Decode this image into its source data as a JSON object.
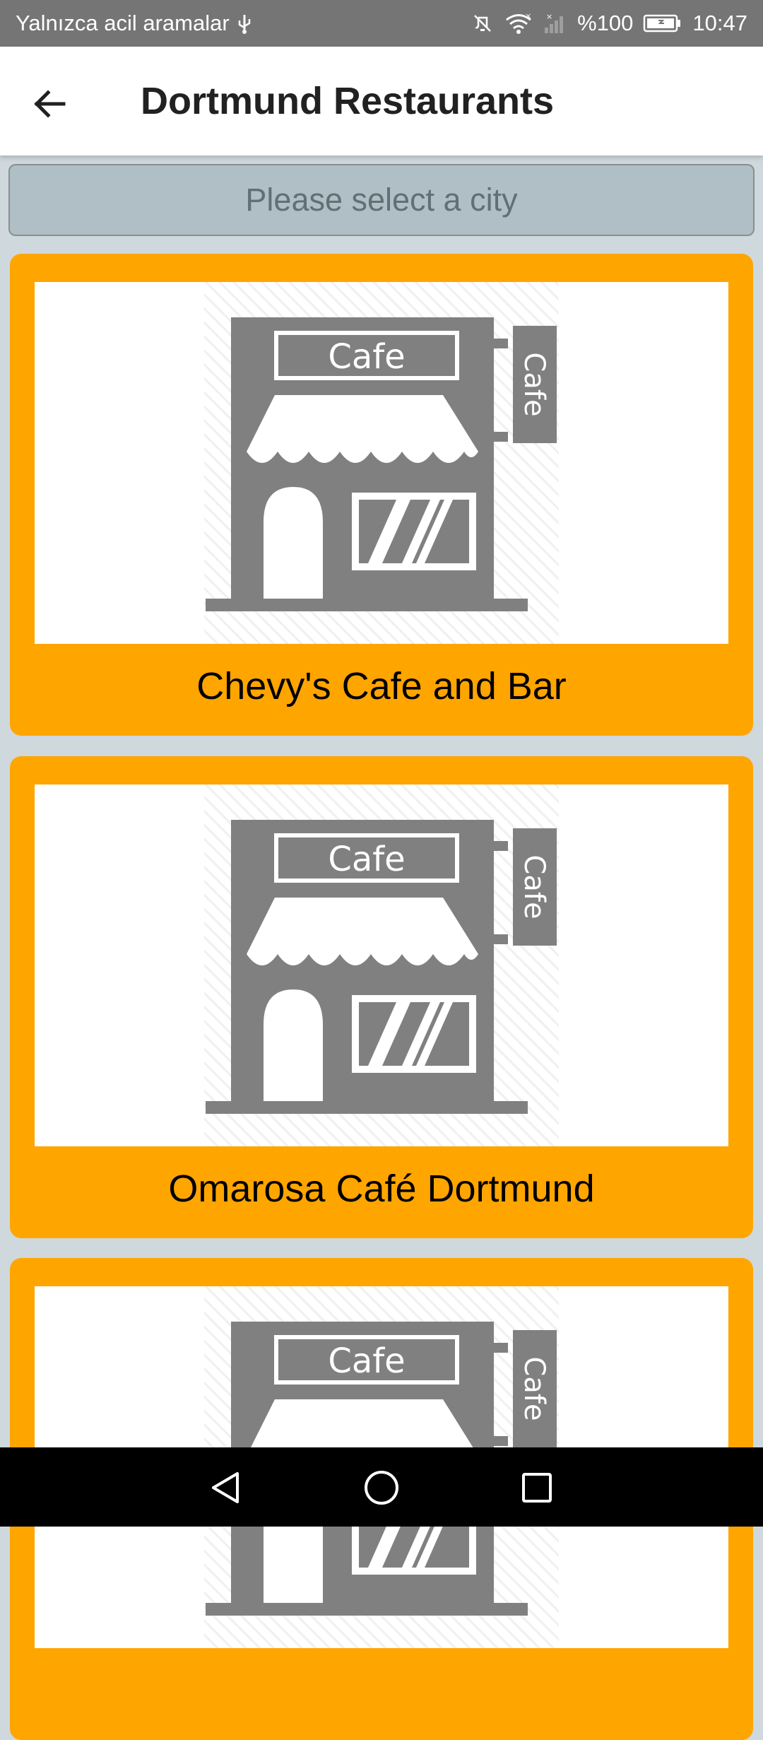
{
  "status_bar": {
    "carrier_text": "Yalnızca acil aramalar",
    "battery_text": "%100",
    "time": "10:47",
    "icons": [
      "usb-icon",
      "mute-icon",
      "wifi-icon",
      "signal-icon",
      "battery-icon"
    ]
  },
  "app_bar": {
    "title": "Dortmund Restaurants",
    "back_icon": "arrow-left-icon"
  },
  "city_select": {
    "placeholder": "Please select a city"
  },
  "restaurants": [
    {
      "name": "Chevy's Cafe and Bar",
      "image_sign": "Cafe",
      "image_side_sign": "Cafe"
    },
    {
      "name": "Omarosa Café Dortmund",
      "image_sign": "Cafe",
      "image_side_sign": "Cafe"
    },
    {
      "name": "",
      "image_sign": "Cafe",
      "image_side_sign": "Cafe"
    }
  ],
  "nav_bar": {
    "icons": [
      "back-triangle-icon",
      "home-circle-icon",
      "recents-square-icon"
    ]
  },
  "colors": {
    "status_bar": "#757575",
    "app_bar": "#ffffff",
    "background": "#cfd8dc",
    "select_fill": "#b0bec5",
    "card": "#ffa500",
    "icon_gray": "#808080",
    "nav_bar": "#000000"
  }
}
